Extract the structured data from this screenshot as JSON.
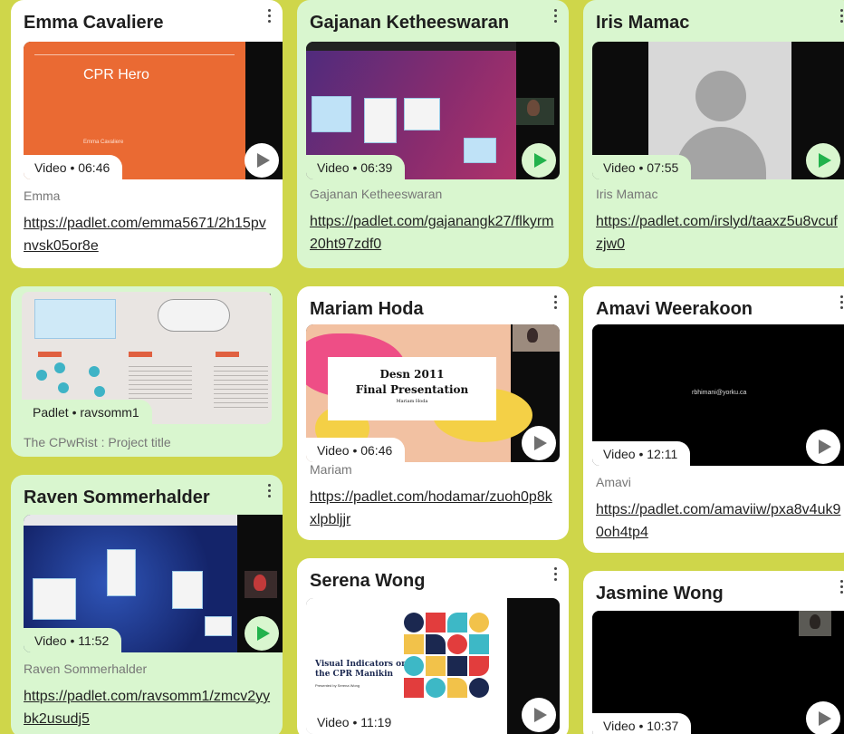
{
  "cards": [
    {
      "title": "Emma Cavaliere",
      "chip": "Video • 06:46",
      "author": "Emma",
      "link": "https://padlet.com/emma5671/2h15pvnvsk05or8e",
      "thumb_title": "CPR Hero",
      "thumb_subtitle": "Emma Cavaliere"
    },
    {
      "title": "Gajanan Ketheeswaran",
      "chip": "Video • 06:39",
      "author": "Gajanan Ketheeswaran",
      "link": "https://padlet.com/gajanangk27/flkyrm20ht97zdf0"
    },
    {
      "title": "Iris Mamac",
      "chip": "Video • 07:55",
      "author": "Iris Mamac",
      "link": "https://padlet.com/irslyd/taaxz5u8vcufzjw0"
    },
    {
      "chip": "Padlet • ravsomm1",
      "author": "The CPwRist : Project title"
    },
    {
      "title": "Mariam Hoda",
      "chip": "Video • 06:46",
      "author": "Mariam",
      "link": "https://padlet.com/hodamar/zuoh0p8kxlpbljjr",
      "thumb_line1": "Desn 2011",
      "thumb_line2": "Final Presentation",
      "thumb_line3": "Mariam Hoda"
    },
    {
      "title": "Amavi Weerakoon",
      "chip": "Video • 12:11",
      "author": "Amavi",
      "link": "https://padlet.com/amaviiw/pxa8v4uk90oh4tp4",
      "thumb_email": "rbhimani@yorku.ca"
    },
    {
      "title": "Raven Sommerhalder",
      "chip": "Video • 11:52",
      "author": "Raven Sommerhalder",
      "link": "https://padlet.com/ravsomm1/zmcv2yybk2usudj5"
    },
    {
      "title": "Serena Wong",
      "chip": "Video • 11:19",
      "thumb_line1": "Visual Indicators on",
      "thumb_line2": "the CPR Manikin",
      "thumb_line3": "Presented by Serena Wong"
    },
    {
      "title": "Jasmine Wong",
      "chip": "Video • 10:37"
    }
  ],
  "colors": {
    "background": "#cfd64a",
    "card_green": "#d9f6cf",
    "card_white": "#ffffff",
    "play_green": "#22b24c"
  }
}
